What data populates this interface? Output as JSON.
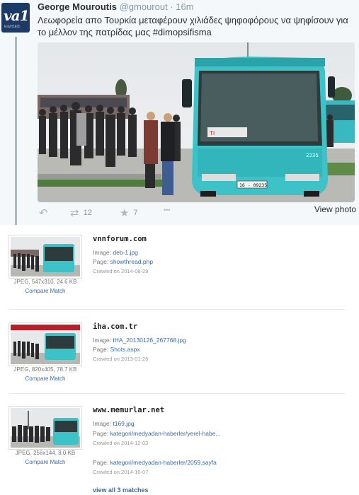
{
  "tweet": {
    "avatar_text": "va1",
    "avatar_subtext": "ΕΙΔΗΣΕΙΣ",
    "name": "George Mouroutis",
    "handle": "@gmourout",
    "separator": "·",
    "time": "16m",
    "text": "Λεωφορεία απο Τουρκία μεταφέρουν χιλιάδες ψηφοφόρους να ψηφίσουν για το μέλλον της πατρίδας μας ",
    "hashtag": "#dimopsifisma",
    "bus_sign": "ΤΙ",
    "bus_plate": "16 - 09235",
    "bus_number": "2235",
    "retweets": "12",
    "favorites": "7",
    "more": "•••",
    "view_photo": "View photo",
    "icons": {
      "reply": "reply-icon",
      "retweet": "retweet-icon",
      "favorite": "star-icon",
      "more": "more-icon"
    }
  },
  "results": [
    {
      "domain": "vnnforum.com",
      "image_label": "Image: ",
      "image_link": "deb-1.jpg",
      "page_label": "Page: ",
      "page_link": "showthread.php",
      "crawled": "Crawled on 2014-08-29",
      "meta": "JPEG, 547x310, 24.6 KB",
      "compare": "Compare Match"
    },
    {
      "domain": "iha.com.tr",
      "image_label": "Image: ",
      "image_link": "IHA_20130126_267768.jpg",
      "page_label": "Page: ",
      "page_link": "Shots.aspx",
      "crawled": "Crawled on 2013-01-26",
      "meta": "JPEG, 820x405, 78.7 KB",
      "compare": "Compare Match"
    },
    {
      "domain": "www.memurlar.net",
      "image_label": "Image: ",
      "image_link": "t169.jpg",
      "page_label": "Page: ",
      "page_link": "kategori/medyadan-haberler/yerel-habe...",
      "crawled": "Crawled on 2014-12-03",
      "page2_label": "Page: ",
      "page2_link": "kategori/medyadan-haberler/2059.sayfa",
      "crawled2": "Crawled on 2014-10-07",
      "meta": "JPEG, 256x144, 8.0 KB",
      "compare": "Compare Match"
    }
  ],
  "view_all": "view all 3 matches",
  "colors": {
    "link": "#3a6aa8",
    "bus": "#2fb5b7",
    "tweet_bg": "#f5f8fa"
  }
}
